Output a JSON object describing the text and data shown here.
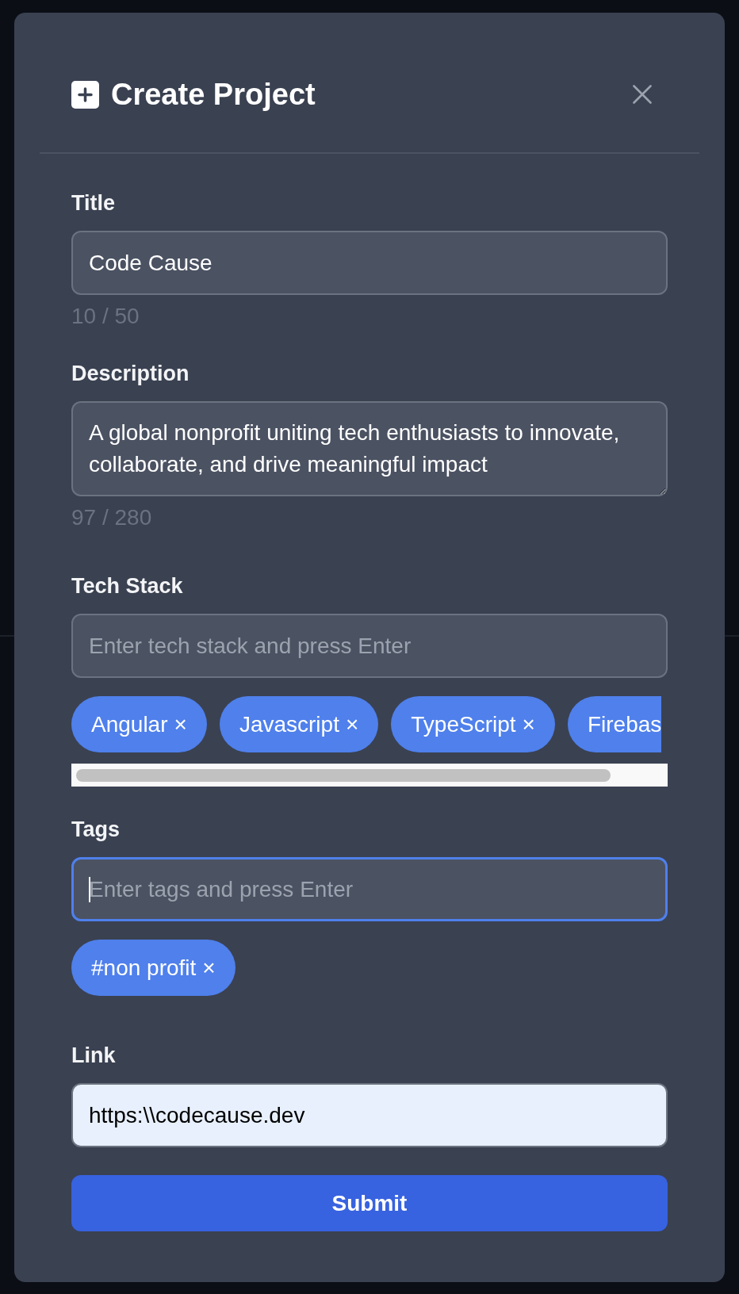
{
  "dialog": {
    "title": "Create Project"
  },
  "fields": [
    {
      "kind": "text",
      "label": "Title",
      "value": "Code Cause",
      "counter": "10 / 50",
      "focused": false,
      "autofilled": false
    },
    {
      "kind": "textarea",
      "label": "Description",
      "value": "A global nonprofit uniting tech enthusiasts to innovate, collaborate, and drive meaningful impact",
      "counter": "97 / 280",
      "focused": false,
      "autofilled": false
    },
    {
      "kind": "chips",
      "label": "Tech Stack",
      "placeholder": "Enter tech stack and press Enter",
      "focused": false,
      "autofilled": false,
      "scrollable": true,
      "chips": [
        {
          "label": "Angular",
          "remove": "×",
          "clipped": false
        },
        {
          "label": "Javascript",
          "remove": "×",
          "clipped": false
        },
        {
          "label": "TypeScript",
          "remove": "×",
          "clipped": false
        },
        {
          "label": "Firebas",
          "clipped": true
        }
      ]
    },
    {
      "kind": "chips",
      "label": "Tags",
      "placeholder": "Enter tags and press Enter",
      "focused": true,
      "autofilled": false,
      "scrollable": false,
      "chips": [
        {
          "label": "#non profit",
          "remove": "×",
          "clipped": false
        }
      ]
    },
    {
      "kind": "text",
      "label": "Link",
      "value": "https:\\\\codecause.dev",
      "focused": false,
      "autofilled": true
    }
  ],
  "submit": {
    "label": "Submit"
  }
}
